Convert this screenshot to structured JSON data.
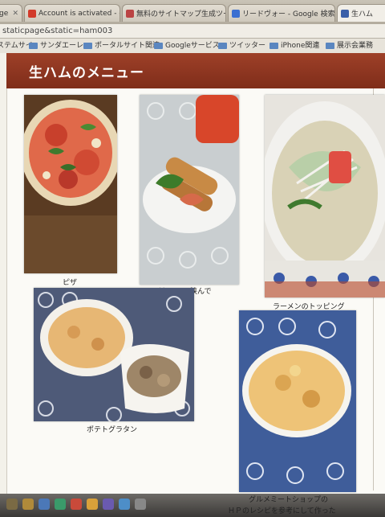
{
  "browser": {
    "tabs": [
      {
        "label": "ge"
      },
      {
        "label": "Account is activated - gooh"
      },
      {
        "label": "無料のサイトマップ生成ツール"
      },
      {
        "label": "リードヴォー - Google 検索"
      },
      {
        "label": "生ハム"
      }
    ],
    "url": "staticpage&static=ham003",
    "bookmarks": [
      "ステムサイ",
      "サンダエーレ",
      "ポータルサイト関連",
      "Googleサービス",
      "ツイッター",
      "iPhone関連",
      "展示会業務"
    ]
  },
  "page": {
    "title": "生ハムのメニュー",
    "menu": [
      {
        "caption": "ピザ"
      },
      {
        "caption": "バケットに挟んで"
      },
      {
        "caption": "ラーメンのトッピング"
      },
      {
        "caption": "ポテトグラタン"
      },
      {
        "caption": "グルメミートショップの"
      },
      {
        "caption": "ＨＰのレシピを参考にして作った"
      }
    ]
  },
  "colors": {
    "banner": "#8f3520",
    "page_bg": "#fbfaf6",
    "bookmark_folder": "#5a86c0"
  }
}
